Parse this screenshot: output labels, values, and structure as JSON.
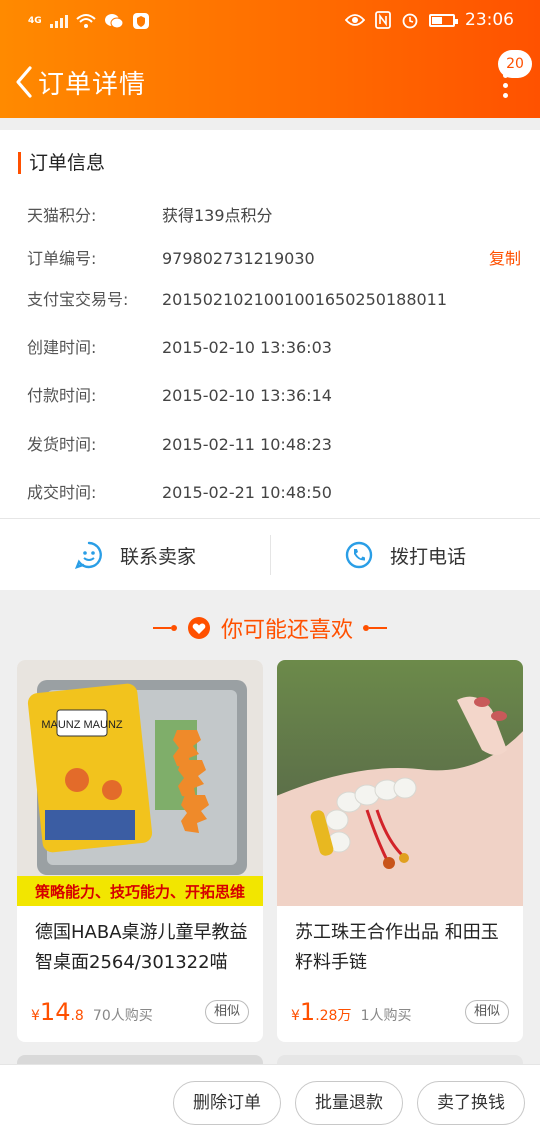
{
  "status_bar": {
    "network": "4G",
    "time": "23:06"
  },
  "header": {
    "title": "订单详情",
    "badge_count": "20"
  },
  "order_info": {
    "section_title": "订单信息",
    "rows": [
      {
        "label": "天猫积分:",
        "value": "获得139点积分"
      },
      {
        "label": "订单编号:",
        "value": "979802731219030"
      },
      {
        "label": "支付宝交易号:",
        "value": "2015021021001001650250188011"
      },
      {
        "label": "创建时间:",
        "value": "2015-02-10 13:36:03"
      },
      {
        "label": "付款时间:",
        "value": "2015-02-10 13:36:14"
      },
      {
        "label": "发货时间:",
        "value": "2015-02-11 10:48:23"
      },
      {
        "label": "成交时间:",
        "value": "2015-02-21 10:48:50"
      }
    ],
    "copy_label": "复制"
  },
  "contact": {
    "seller_label": "联系卖家",
    "phone_label": "拨打电话"
  },
  "recommend": {
    "title": "你可能还喜欢",
    "products": [
      {
        "name": "德国HABA桌游儿童早教益智桌面2564/301322喵",
        "image_caption": "策略能力、技巧能力、开拓思维",
        "image_brand": "MAUNZ MAUNZ",
        "currency": "¥",
        "price_int": "14",
        "price_dec": ".8",
        "price_unit": "",
        "sold": "70人购买",
        "similar": "相似"
      },
      {
        "name": "苏工珠王合作出品 和田玉籽料手链",
        "currency": "¥",
        "price_int": "1",
        "price_dec": ".28",
        "price_unit": "万",
        "sold": "1人购买",
        "similar": "相似"
      }
    ]
  },
  "actions": {
    "delete": "删除订单",
    "refund": "批量退款",
    "sell": "卖了换钱"
  },
  "colors": {
    "accent": "#ff5000",
    "header_start": "#ff8a00",
    "header_end": "#ff5200"
  }
}
